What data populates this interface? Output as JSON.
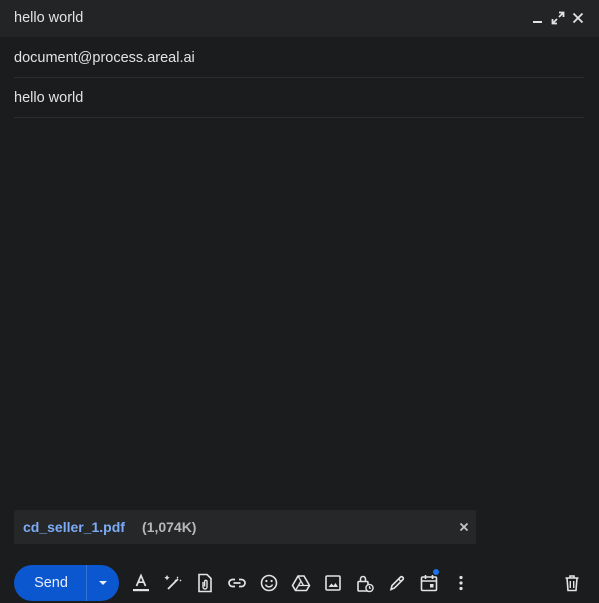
{
  "header": {
    "title": "hello world",
    "minimize_icon": "minimize-icon",
    "expand_icon": "expand-icon",
    "close_icon": "close-icon"
  },
  "fields": {
    "recipient": "document@process.areal.ai",
    "subject": "hello world"
  },
  "body": {
    "text": ""
  },
  "attachment": {
    "filename": "cd_seller_1.pdf",
    "size": "(1,074K)"
  },
  "toolbar": {
    "send_label": "Send",
    "icons": [
      "text-format-icon",
      "magic-pen-icon",
      "attach-file-icon",
      "link-icon",
      "emoji-icon",
      "drive-icon",
      "image-icon",
      "confidential-lock-icon",
      "signature-pen-icon",
      "schedule-calendar-icon",
      "more-options-icon",
      "trash-icon"
    ]
  },
  "colors": {
    "background": "#1b1c1d",
    "header": "#232425",
    "accent": "#0b57d0",
    "link": "#7cacf8",
    "text": "#e3e3e3"
  }
}
